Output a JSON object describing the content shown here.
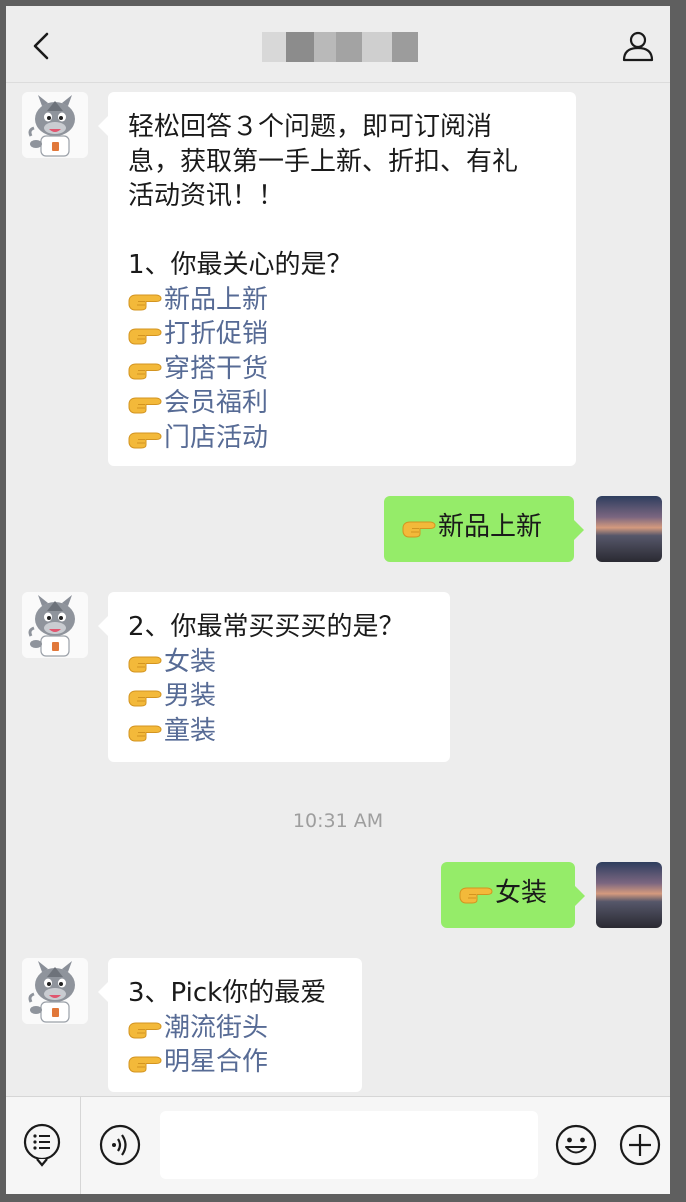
{
  "header": {
    "title": "",
    "back_icon": "chevron-left-icon",
    "profile_icon": "person-icon"
  },
  "messages": [
    {
      "from": "bot",
      "lines": [
        "轻松回答３个问题，即可订阅消",
        "息，获取第一手上新、折扣、有礼",
        "活动资讯！！",
        "",
        "1、你最关心的是？"
      ],
      "options": [
        "新品上新",
        "打折促销",
        "穿搭干货",
        "会员福利",
        "门店活动"
      ]
    },
    {
      "from": "me",
      "text": "新品上新"
    },
    {
      "from": "bot",
      "lines": [
        "2、你最常买买买的是？"
      ],
      "options": [
        "女装",
        "男装",
        "童装"
      ]
    },
    {
      "from": "me",
      "text": "女装"
    },
    {
      "from": "bot",
      "lines": [
        "3、Pick你的最爱"
      ],
      "options": [
        "潮流街头",
        "明星合作"
      ]
    }
  ],
  "timestamp": "10:31 AM",
  "input_bar": {
    "menu_icon": "menu-icon",
    "voice_icon": "voice-icon",
    "input_value": "",
    "emoji_icon": "emoji-icon",
    "add_icon": "plus-icon"
  },
  "colors": {
    "link": "#576b95",
    "bubble_out": "#95ec69",
    "bubble_in": "#ffffff",
    "background": "#ededed"
  }
}
